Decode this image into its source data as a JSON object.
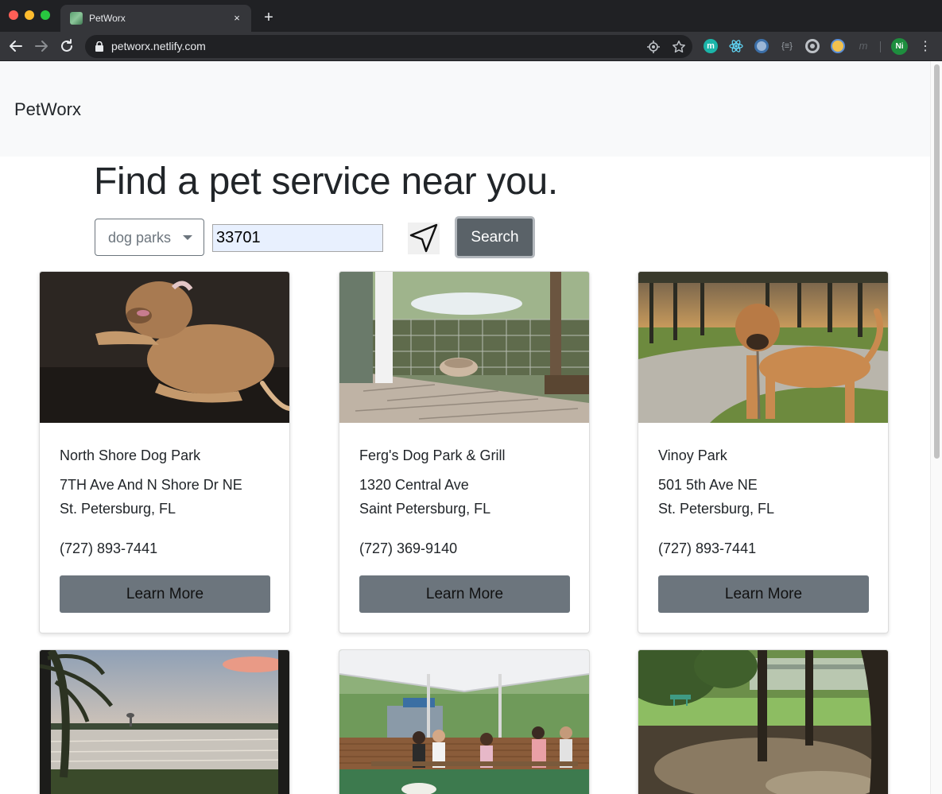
{
  "browser": {
    "tab_title": "PetWorx",
    "tab_close": "×",
    "new_tab": "+",
    "url": "petworx.netlify.com",
    "extensions": {
      "m_label": "m",
      "brace_label": "{≡}",
      "faded_label": "m"
    },
    "profile_initials": "Ni",
    "menu": "⋮"
  },
  "navbar": {
    "brand": "PetWorx"
  },
  "hero": {
    "title": "Find a pet service near you."
  },
  "search": {
    "category_selected": "dog parks",
    "zip_value": "33701",
    "search_label": "Search"
  },
  "results": [
    {
      "name": "North Shore Dog Park",
      "address_line1": "7TH Ave And N Shore Dr NE",
      "address_line2": "St. Petersburg, FL",
      "phone": "(727) 893-7441",
      "button": "Learn More"
    },
    {
      "name": "Ferg's Dog Park & Grill",
      "address_line1": "1320 Central Ave",
      "address_line2": "Saint Petersburg, FL",
      "phone": "(727) 369-9140",
      "button": "Learn More"
    },
    {
      "name": "Vinoy Park",
      "address_line1": "501 5th Ave NE",
      "address_line2": "St. Petersburg, FL",
      "phone": "(727) 893-7441",
      "button": "Learn More"
    }
  ],
  "colors": {
    "navbar_bg": "#f8f9fa",
    "button_secondary": "#6c757d",
    "search_button": "#5a6268",
    "input_autofill": "#e8f0fe",
    "browser_dark": "#202124",
    "browser_toolbar": "#35363a"
  }
}
